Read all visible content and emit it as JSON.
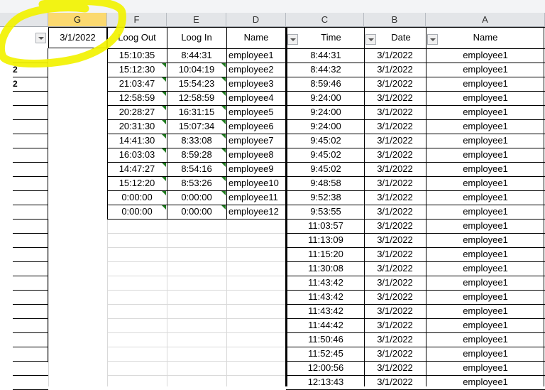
{
  "column_letters": [
    "G",
    "F",
    "E",
    "D",
    "C",
    "B",
    "A"
  ],
  "left_table": {
    "header": {
      "date_value": "3/1/2022",
      "log_out": "Loog Out",
      "log_in": "Loog In",
      "name": "Name"
    },
    "row_labels": [
      "",
      "2",
      "2"
    ],
    "rows": [
      {
        "log_out": "15:10:35",
        "log_in": "8:44:31",
        "name": "employee1"
      },
      {
        "log_out": "15:12:30",
        "log_in": "10:04:19",
        "name": "employee2"
      },
      {
        "log_out": "21:03:47",
        "log_in": "15:54:23",
        "name": "employee3"
      },
      {
        "log_out": "12:58:59",
        "log_in": "12:58:59",
        "name": "employee4"
      },
      {
        "log_out": "20:28:27",
        "log_in": "16:31:15",
        "name": "employee5"
      },
      {
        "log_out": "20:31:30",
        "log_in": "15:07:34",
        "name": "employee6"
      },
      {
        "log_out": "14:41:30",
        "log_in": "8:33:08",
        "name": "employee7"
      },
      {
        "log_out": "16:03:03",
        "log_in": "8:59:28",
        "name": "employee8"
      },
      {
        "log_out": "14:47:27",
        "log_in": "8:54:16",
        "name": "employee9"
      },
      {
        "log_out": "15:12:20",
        "log_in": "8:53:26",
        "name": "employee10"
      },
      {
        "log_out": "0:00:00",
        "log_in": "0:00:00",
        "name": "employee11"
      },
      {
        "log_out": "0:00:00",
        "log_in": "0:00:00",
        "name": "employee12"
      }
    ]
  },
  "right_table": {
    "header": {
      "time": "Time",
      "date": "Date",
      "name": "Name"
    },
    "rows": [
      {
        "time": "8:44:31",
        "date": "3/1/2022",
        "name": "employee1"
      },
      {
        "time": "8:44:32",
        "date": "3/1/2022",
        "name": "employee1"
      },
      {
        "time": "8:59:46",
        "date": "3/1/2022",
        "name": "employee1"
      },
      {
        "time": "9:24:00",
        "date": "3/1/2022",
        "name": "employee1"
      },
      {
        "time": "9:24:00",
        "date": "3/1/2022",
        "name": "employee1"
      },
      {
        "time": "9:24:00",
        "date": "3/1/2022",
        "name": "employee1"
      },
      {
        "time": "9:45:02",
        "date": "3/1/2022",
        "name": "employee1"
      },
      {
        "time": "9:45:02",
        "date": "3/1/2022",
        "name": "employee1"
      },
      {
        "time": "9:45:02",
        "date": "3/1/2022",
        "name": "employee1"
      },
      {
        "time": "9:48:58",
        "date": "3/1/2022",
        "name": "employee1"
      },
      {
        "time": "9:52:38",
        "date": "3/1/2022",
        "name": "employee1"
      },
      {
        "time": "9:53:55",
        "date": "3/1/2022",
        "name": "employee1"
      },
      {
        "time": "11:03:57",
        "date": "3/1/2022",
        "name": "employee1"
      },
      {
        "time": "11:13:09",
        "date": "3/1/2022",
        "name": "employee1"
      },
      {
        "time": "11:15:20",
        "date": "3/1/2022",
        "name": "employee1"
      },
      {
        "time": "11:30:08",
        "date": "3/1/2022",
        "name": "employee1"
      },
      {
        "time": "11:43:42",
        "date": "3/1/2022",
        "name": "employee1"
      },
      {
        "time": "11:43:42",
        "date": "3/1/2022",
        "name": "employee1"
      },
      {
        "time": "11:43:42",
        "date": "3/1/2022",
        "name": "employee1"
      },
      {
        "time": "11:44:42",
        "date": "3/1/2022",
        "name": "employee1"
      },
      {
        "time": "11:50:46",
        "date": "3/1/2022",
        "name": "employee1"
      },
      {
        "time": "11:52:45",
        "date": "3/1/2022",
        "name": "employee1"
      },
      {
        "time": "12:00:56",
        "date": "3/1/2022",
        "name": "employee1"
      },
      {
        "time": "12:13:43",
        "date": "3/1/2022",
        "name": "employee1"
      }
    ]
  },
  "colors": {
    "highlight": "#f2f200",
    "selected_col_header": "#fbd96f",
    "header_bg": "#e3e5e8",
    "comment_indicator": "#1f7a1f"
  }
}
